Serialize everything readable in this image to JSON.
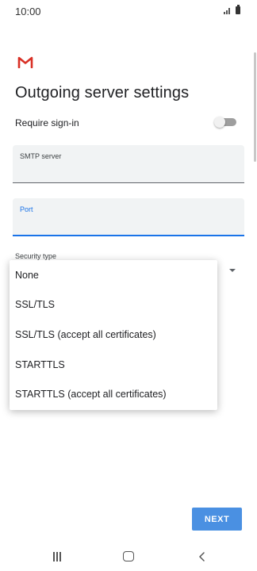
{
  "status_bar": {
    "time": "10:00"
  },
  "app": {
    "logo_icon": "gmail-logo-icon",
    "logo_color": "#d93025"
  },
  "page": {
    "title": "Outgoing server settings"
  },
  "require_signin": {
    "label": "Require sign-in",
    "enabled": false
  },
  "smtp_server": {
    "label": "SMTP server",
    "value": ""
  },
  "port": {
    "label": "Port",
    "value": ""
  },
  "security_type": {
    "label": "Security type",
    "options": [
      "None",
      "SSL/TLS",
      "SSL/TLS (accept all certificates)",
      "STARTTLS",
      "STARTTLS (accept all certificates)"
    ]
  },
  "actions": {
    "next_label": "NEXT"
  },
  "colors": {
    "accent": "#1a73e8",
    "button": "#4a90e2",
    "field_background": "#f1f3f4"
  },
  "nav_bar": {
    "recents_icon": "recent-apps-icon",
    "home_icon": "home-icon",
    "back_icon": "back-icon"
  }
}
